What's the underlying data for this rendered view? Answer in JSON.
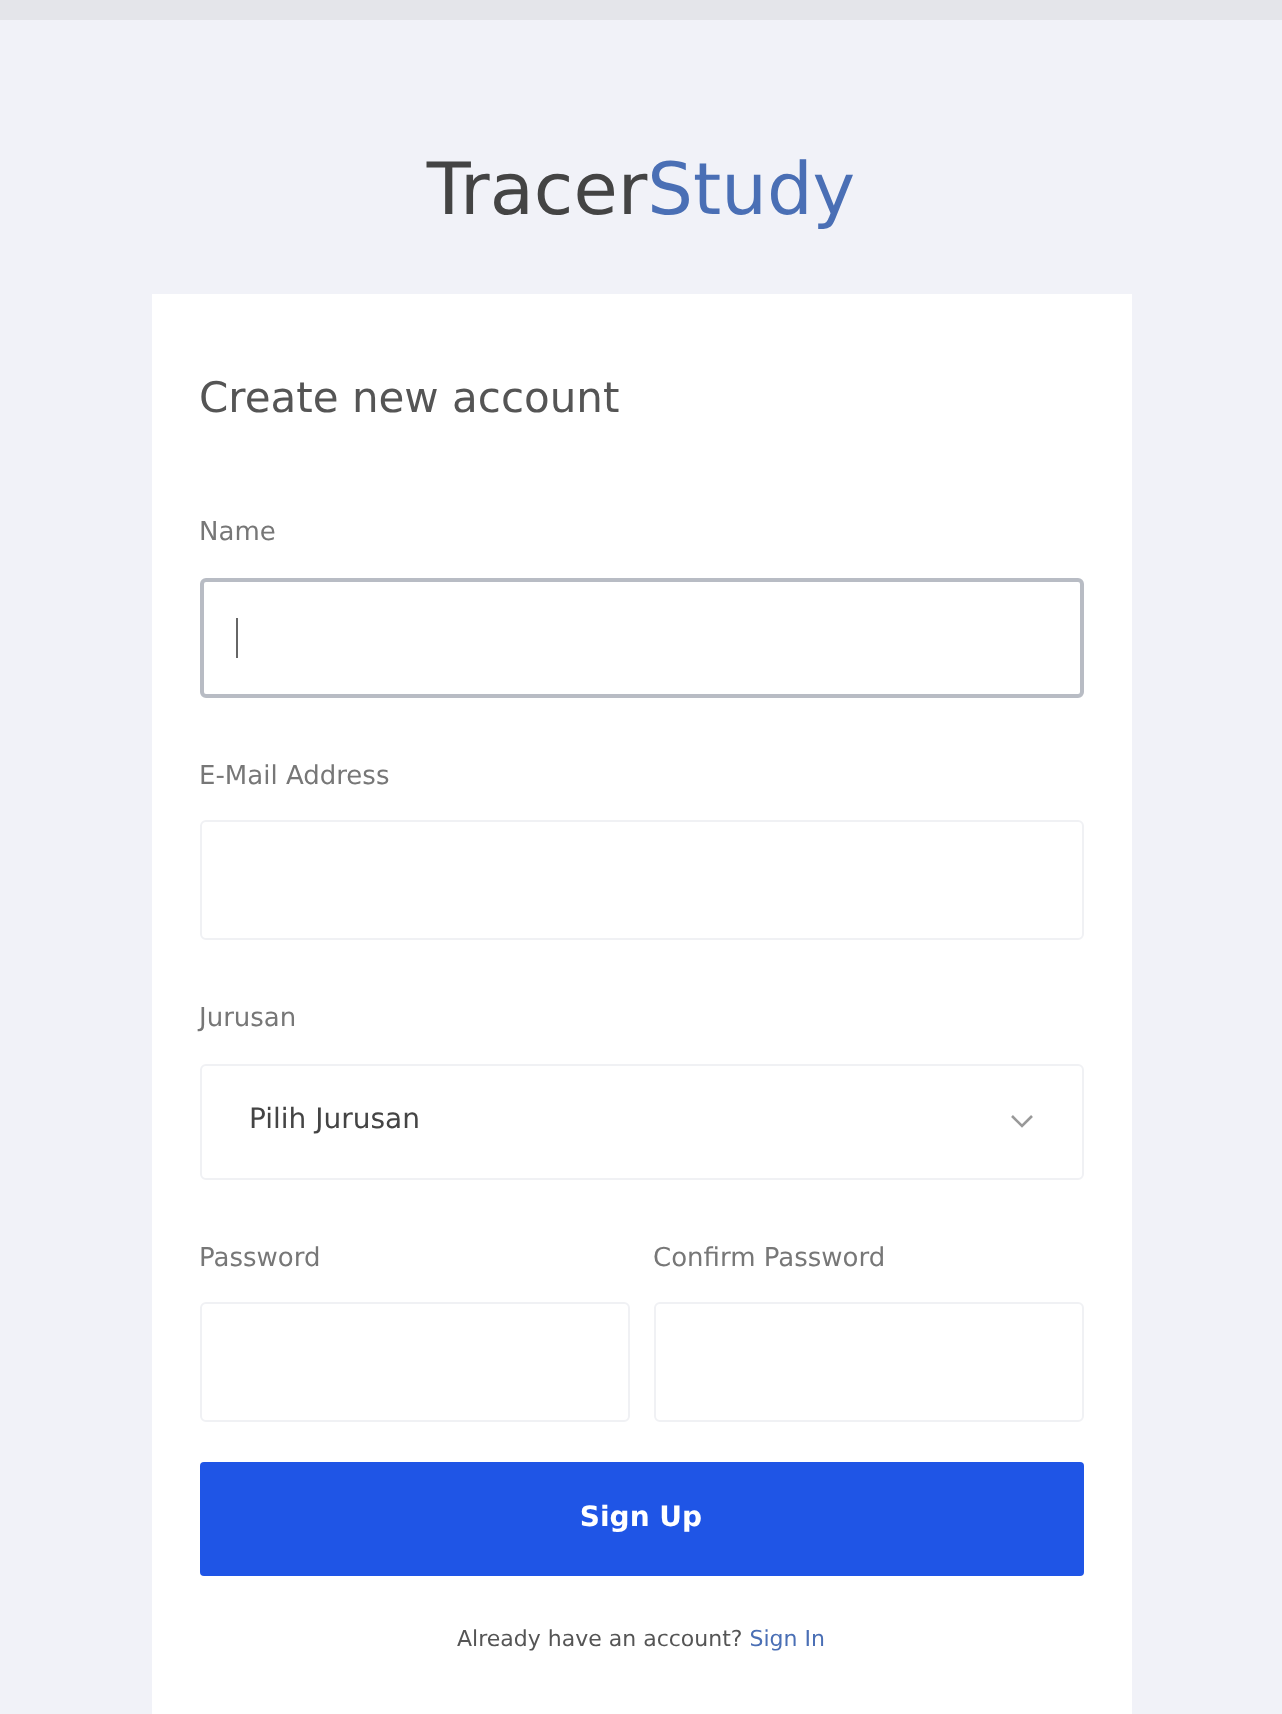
{
  "logo": {
    "parts": [
      {
        "text": "Tracer",
        "kind": "plain"
      },
      {
        "text": "Study",
        "kind": "accent"
      }
    ]
  },
  "form": {
    "title": "Create new account",
    "fields": [
      {
        "kind": "text",
        "label": "Name",
        "focused": true
      },
      {
        "kind": "text",
        "label": "E-Mail Address",
        "focused": false
      },
      {
        "kind": "select",
        "label": "Jurusan",
        "value": "Pilih Jurusan",
        "focused": false
      }
    ],
    "password_fields": [
      {
        "label": "Password",
        "focused": false
      },
      {
        "label": "Confirm Password",
        "focused": false
      }
    ],
    "submit": "Sign Up",
    "footer": {
      "text": "Already have an account?",
      "link": "Sign In"
    }
  }
}
